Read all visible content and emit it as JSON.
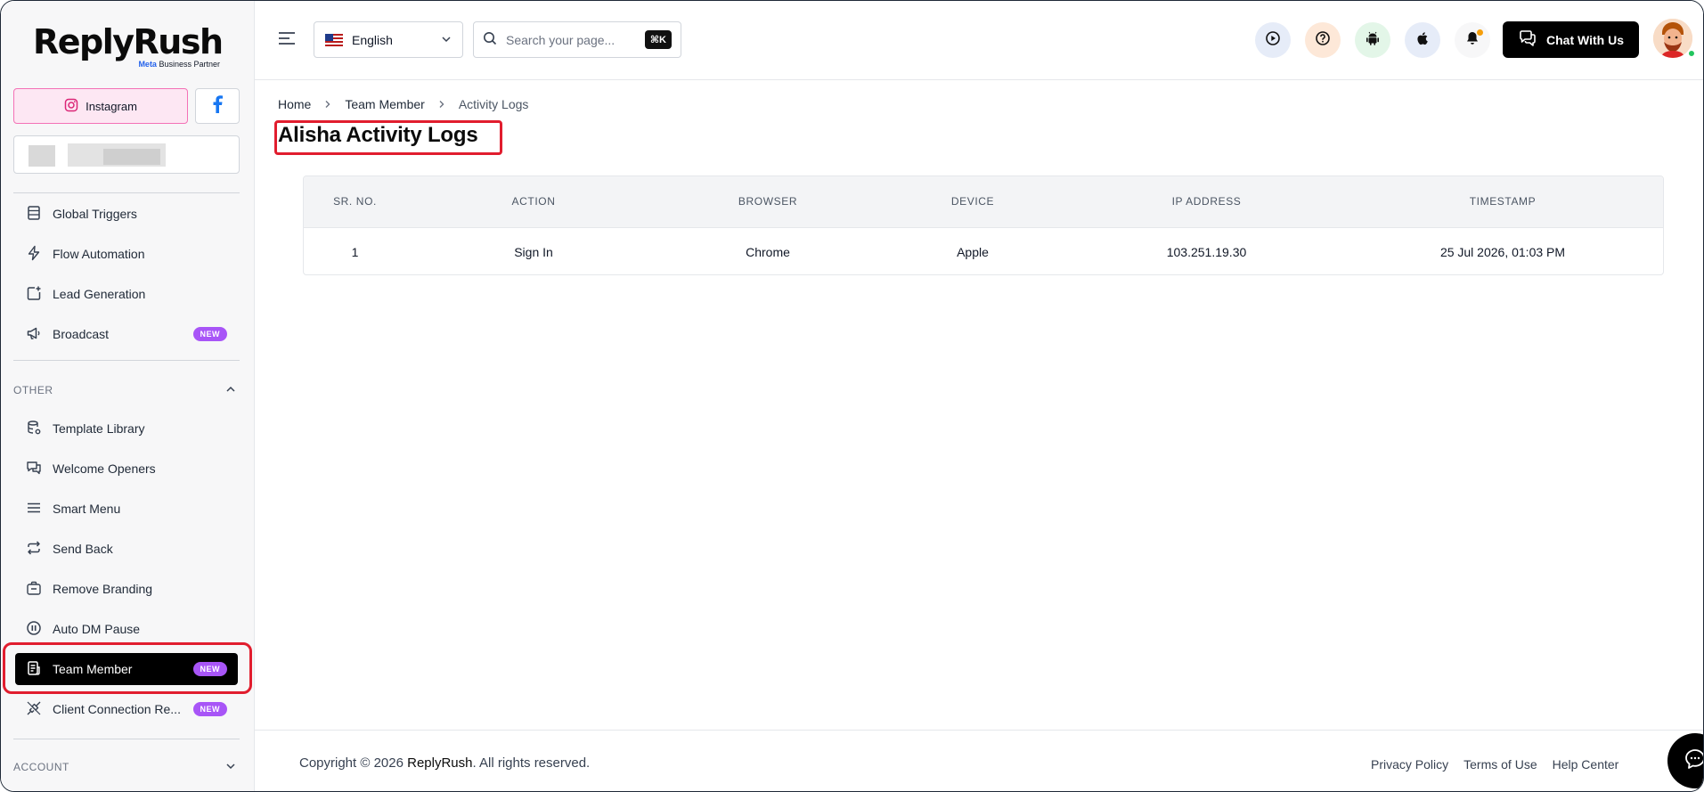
{
  "brand": {
    "logo_text": "ReplyRush",
    "logo_subtext_meta": "Meta",
    "logo_subtext_rest": " Business Partner"
  },
  "sidebar": {
    "platforms": {
      "instagram_label": "Instagram"
    },
    "items_top": [
      {
        "label": "Global Triggers",
        "icon": "table-icon"
      },
      {
        "label": "Flow Automation",
        "icon": "lightning-icon"
      },
      {
        "label": "Lead Generation",
        "icon": "plus-square-icon"
      },
      {
        "label": "Broadcast",
        "icon": "megaphone-icon",
        "badge": "NEW"
      }
    ],
    "section_other": "OTHER",
    "items_other": [
      {
        "label": "Template Library",
        "icon": "database-gear-icon"
      },
      {
        "label": "Welcome Openers",
        "icon": "chat-bubbles-icon"
      },
      {
        "label": "Smart Menu",
        "icon": "hamburger-icon"
      },
      {
        "label": "Send Back",
        "icon": "repeat-icon"
      },
      {
        "label": "Remove Branding",
        "icon": "briefcase-icon"
      },
      {
        "label": "Auto DM Pause",
        "icon": "pause-circle-icon"
      },
      {
        "label": "Team Member",
        "icon": "document-list-icon",
        "badge": "NEW",
        "active": true
      },
      {
        "label": "Client Connection Re...",
        "icon": "plug-icon",
        "badge": "NEW"
      }
    ],
    "section_account": "ACCOUNT"
  },
  "header": {
    "language": "English",
    "search_placeholder": "Search your page...",
    "search_shortcut": "⌘K",
    "chat_button": "Chat With Us"
  },
  "breadcrumb": {
    "home": "Home",
    "team_member": "Team Member",
    "current": "Activity Logs"
  },
  "page": {
    "title": "Alisha Activity Logs"
  },
  "table": {
    "headers": [
      "SR. NO.",
      "ACTION",
      "BROWSER",
      "DEVICE",
      "IP ADDRESS",
      "TIMESTAMP"
    ],
    "rows": [
      [
        "1",
        "Sign In",
        "Chrome",
        "Apple",
        "103.251.19.30",
        "25 Jul 2026, 01:03 PM"
      ]
    ]
  },
  "footer": {
    "copyright_prefix": "Copyright © 2026 ",
    "copyright_brand": "ReplyRush",
    "copyright_suffix": ". All rights reserved.",
    "links": [
      "Privacy Policy",
      "Terms of Use",
      "Help Center"
    ]
  },
  "colors": {
    "accent_badge": "#a855f7",
    "highlight_red": "#e11d2e",
    "instagram_pink": "#f472b6",
    "facebook_blue": "#1877f2"
  }
}
